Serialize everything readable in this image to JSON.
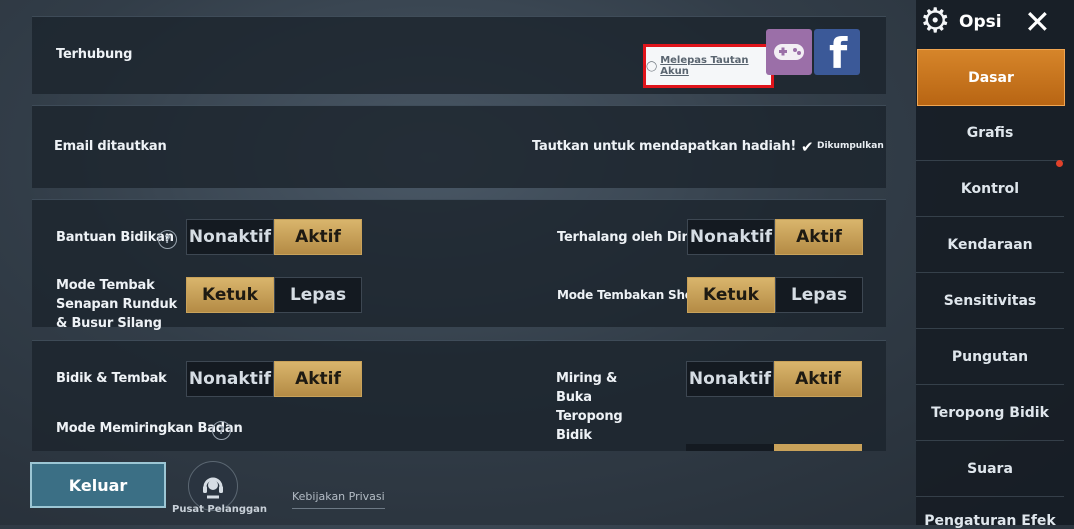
{
  "account": {
    "connected_label": "Terhubung",
    "unlink_label": "Melepas Tautan Akun",
    "email_label": "Email ditautkan",
    "reward_label": "Tautkan untuk mendapatkan hadiah!",
    "collected_label": "Dikumpulkan"
  },
  "settings": [
    {
      "label": "Bantuan Bidikan",
      "options": [
        "Nonaktif",
        "Aktif"
      ],
      "selected": "Aktif"
    },
    {
      "label": "Terhalang oleh Dinding",
      "options": [
        "Nonaktif",
        "Aktif"
      ],
      "selected": "Aktif"
    },
    {
      "label": "Mode Tembak Senapan Runduk & Busur Silang",
      "options": [
        "Ketuk",
        "Lepas"
      ],
      "selected": "Ketuk"
    },
    {
      "label": "Mode Tembakan Shotgun",
      "options": [
        "Ketuk",
        "Lepas"
      ],
      "selected": "Ketuk"
    },
    {
      "label": "Bidik & Tembak",
      "options": [
        "Nonaktif",
        "Aktif"
      ],
      "selected": "Aktif"
    },
    {
      "label": "Miring & Buka Teropong Bidik",
      "options": [
        "Nonaktif",
        "Aktif"
      ],
      "selected": "Aktif"
    },
    {
      "label": "Mode Memiringkan Badan"
    }
  ],
  "help_glyph": "?",
  "footer": {
    "exit_label": "Keluar",
    "support_label": "Pusat Pelanggan",
    "privacy_label": "Kebijakan Privasi"
  },
  "sidebar": {
    "title": "Opsi",
    "items": [
      "Dasar",
      "Grafis",
      "Kontrol",
      "Kendaraan",
      "Sensitivitas",
      "Pungutan",
      "Teropong Bidik",
      "Suara",
      "Pengaturan Efek"
    ],
    "active": "Dasar"
  },
  "colors": {
    "accent": "#c8a15a",
    "active_tab": "#cc7a22",
    "highlight_box": "#e0141b",
    "facebook": "#3b5998",
    "gamepad": "#9b6fa8"
  }
}
